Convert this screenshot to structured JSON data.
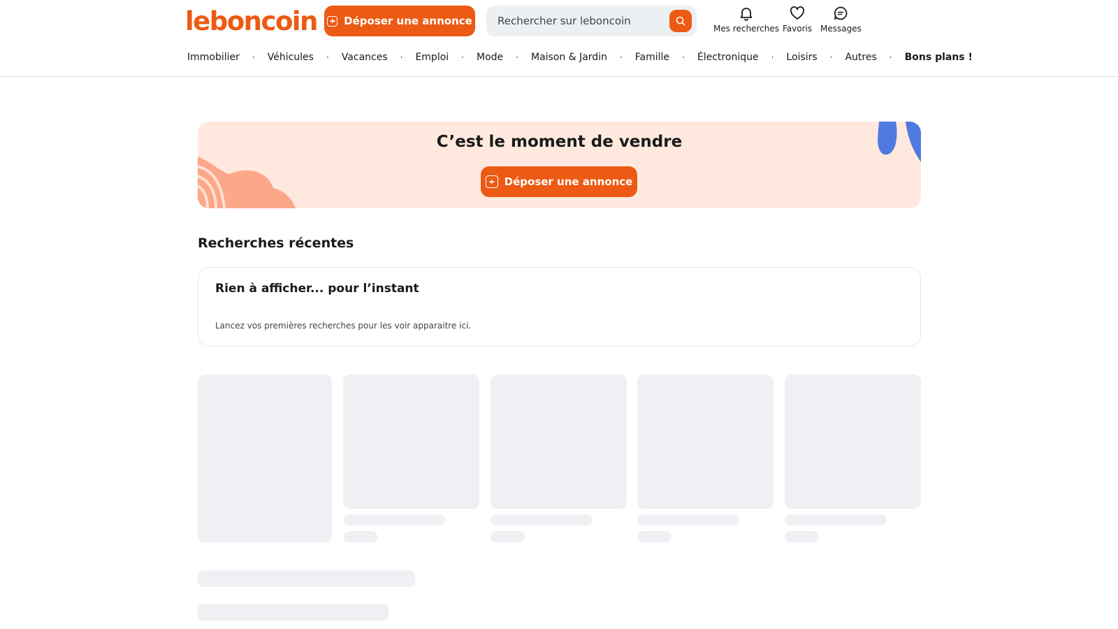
{
  "header": {
    "logo": "leboncoin",
    "post_button_label": "Déposer une annonce",
    "search_placeholder": "Rechercher sur leboncoin",
    "icons": [
      {
        "label": "Mes recherches",
        "icon": "bell-icon"
      },
      {
        "label": "Favoris",
        "icon": "heart-icon"
      },
      {
        "label": "Messages",
        "icon": "chat-icon"
      }
    ]
  },
  "categories": [
    "Immobilier",
    "Véhicules",
    "Vacances",
    "Emploi",
    "Mode",
    "Maison & Jardin",
    "Famille",
    "Électronique",
    "Loisirs",
    "Autres",
    "Bons plans !"
  ],
  "banner": {
    "title": "C’est le moment de vendre",
    "button_label": "Déposer une annonce"
  },
  "recent_searches": {
    "title": "Recherches récentes",
    "empty_title": "Rien à afficher... pour l’instant",
    "empty_text": "Lancez vos premières recherches pour les voir apparaitre ici."
  },
  "colors": {
    "accent": "#ec5a13",
    "banner_bg": "#ffe9de",
    "skeleton": "#eef0f3"
  }
}
